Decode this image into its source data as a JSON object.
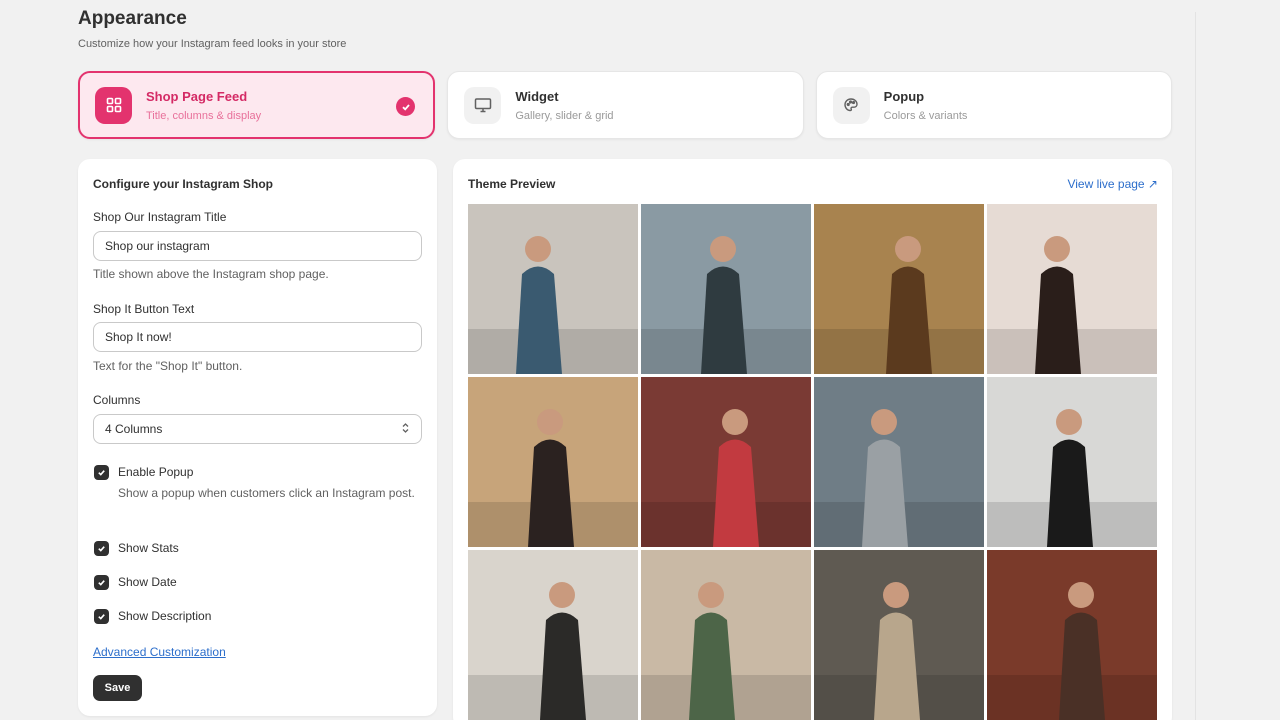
{
  "header": {
    "title": "Appearance",
    "subtitle": "Customize how your Instagram feed looks in your store"
  },
  "tabs": [
    {
      "title": "Shop Page Feed",
      "subtitle": "Title, columns & display",
      "icon": "grid-icon",
      "active": true
    },
    {
      "title": "Widget",
      "subtitle": "Gallery, slider & grid",
      "icon": "monitor-icon",
      "active": false
    },
    {
      "title": "Popup",
      "subtitle": "Colors & variants",
      "icon": "palette-icon",
      "active": false
    }
  ],
  "config": {
    "heading": "Configure your Instagram Shop",
    "title_field": {
      "label": "Shop Our Instagram Title",
      "value": "Shop our instagram",
      "help": "Title shown above the Instagram shop page."
    },
    "button_field": {
      "label": "Shop It Button Text",
      "value": "Shop It now!",
      "help": "Text for the \"Shop It\" button."
    },
    "columns": {
      "label": "Columns",
      "value": "4 Columns"
    },
    "checkboxes": [
      {
        "label": "Enable Popup",
        "help": "Show a popup when customers click an Instagram post.",
        "checked": true
      },
      {
        "label": "Show Stats",
        "checked": true
      },
      {
        "label": "Show Date",
        "checked": true
      },
      {
        "label": "Show Description",
        "checked": true
      }
    ],
    "advanced_link": "Advanced Customization",
    "save_label": "Save"
  },
  "preview": {
    "heading": "Theme Preview",
    "live_link": "View live page ↗",
    "photos": [
      {
        "bg": "#c9c4bd",
        "fg": "#3a5a70"
      },
      {
        "bg": "#8a9aa3",
        "fg": "#2f3b40"
      },
      {
        "bg": "#a8834f",
        "fg": "#5b3a1e"
      },
      {
        "bg": "#e6dbd4",
        "fg": "#2a1e1a"
      },
      {
        "bg": "#c7a47a",
        "fg": "#2b2220"
      },
      {
        "bg": "#7a3a34",
        "fg": "#c23a40"
      },
      {
        "bg": "#6f7d86",
        "fg": "#9aa0a4"
      },
      {
        "bg": "#d8d8d6",
        "fg": "#1a1a1a"
      },
      {
        "bg": "#d9d4cc",
        "fg": "#2b2a28"
      },
      {
        "bg": "#c9b9a5",
        "fg": "#4d6548"
      },
      {
        "bg": "#5f5a52",
        "fg": "#b8a68c"
      },
      {
        "bg": "#7a3a2a",
        "fg": "#4a3026"
      }
    ]
  },
  "colors": {
    "accent": "#e3336e",
    "accent_bg": "#fde8ef",
    "link": "#2c6ecb",
    "dark": "#303030"
  }
}
